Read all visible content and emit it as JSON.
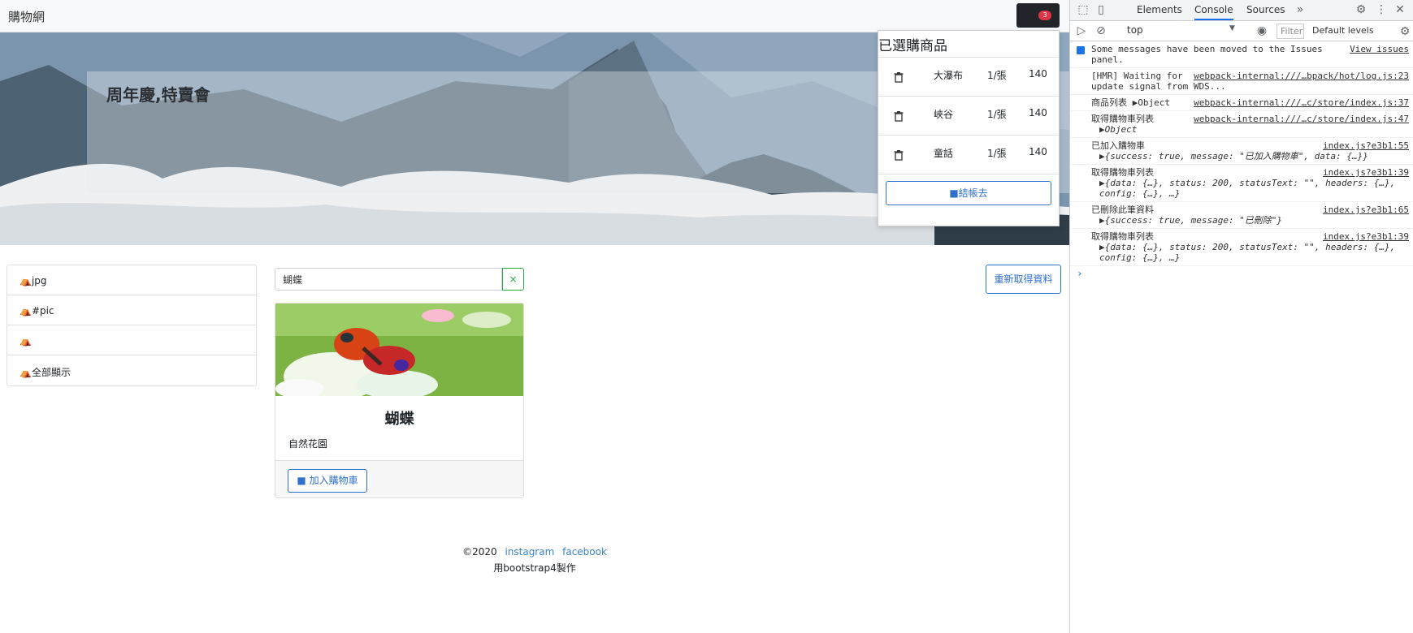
{
  "navbar": {
    "brand": "購物網",
    "cart_count": "3"
  },
  "hero": {
    "title": "周年慶,特賣會"
  },
  "cart_dropdown": {
    "title": "已選購商品",
    "items": [
      {
        "name": "大瀑布",
        "qty": "1/張",
        "price": "140"
      },
      {
        "name": "峽谷",
        "qty": "1/張",
        "price": "140"
      },
      {
        "name": "童話",
        "qty": "1/張",
        "price": "140"
      }
    ],
    "checkout_label": "結帳去"
  },
  "sidebar": {
    "items": [
      "jpg",
      "#pic",
      "",
      "全部顯示"
    ]
  },
  "search": {
    "value": "蝴蝶",
    "clear_label": "×"
  },
  "refresh_label": "重新取得資料",
  "product": {
    "title": "蝴蝶",
    "category": "自然花園",
    "add_label": "加入購物車"
  },
  "footer": {
    "copyright": "©2020",
    "link1": "instagram",
    "link2": "facebook",
    "made_with": "用bootstrap4製作"
  },
  "devtools": {
    "tabs": [
      "Elements",
      "Console",
      "Sources"
    ],
    "active_tab": "Console",
    "context": "top",
    "filter_placeholder": "Filter",
    "levels": "Default levels",
    "messages": [
      {
        "text": "Some messages have been moved to the Issues panel.",
        "src": "View issues"
      },
      {
        "text": "[HMR] Waiting for update signal from WDS...",
        "src": "webpack-internal:///…bpack/hot/log.js:23"
      },
      {
        "text": "商品列表 ▶Object",
        "src": "webpack-internal:///…c/store/index.js:37"
      },
      {
        "text": "取得購物車列表",
        "obj": "▶Object",
        "src": "webpack-internal:///…c/store/index.js:47"
      },
      {
        "text": "已加入購物車",
        "obj": "▶{success: true, message: \"已加入購物車\", data: {…}}",
        "src": "index.js?e3b1:55"
      },
      {
        "text": "取得購物車列表",
        "obj": "▶{data: {…}, status: 200, statusText: \"\", headers: {…}, config: {…}, …}",
        "src": "index.js?e3b1:39"
      },
      {
        "text": "已刪除此筆資料",
        "obj": "▶{success: true, message: \"已刪除\"}",
        "src": "index.js?e3b1:65"
      },
      {
        "text": "取得購物車列表",
        "obj": "▶{data: {…}, status: 200, statusText: \"\", headers: {…}, config: {…}, …}",
        "src": "index.js?e3b1:39"
      }
    ]
  }
}
